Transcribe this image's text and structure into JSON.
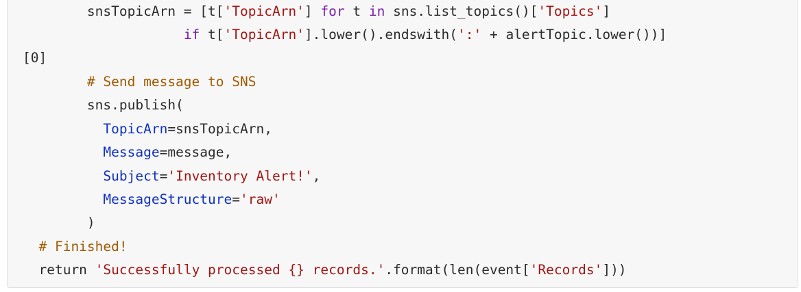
{
  "code": {
    "lines": [
      {
        "indent": "        ",
        "tokens": [
          {
            "t": "snsTopicArn = [t[",
            "c": "plain"
          },
          {
            "t": "'TopicArn'",
            "c": "str"
          },
          {
            "t": "] ",
            "c": "plain"
          },
          {
            "t": "for",
            "c": "kw"
          },
          {
            "t": " t ",
            "c": "plain"
          },
          {
            "t": "in",
            "c": "kw"
          },
          {
            "t": " sns.list_topics()[",
            "c": "plain"
          },
          {
            "t": "'Topics'",
            "c": "str"
          },
          {
            "t": "]",
            "c": "plain"
          }
        ]
      },
      {
        "indent": "                    ",
        "tokens": [
          {
            "t": "if",
            "c": "kw"
          },
          {
            "t": " t[",
            "c": "plain"
          },
          {
            "t": "'TopicArn'",
            "c": "str"
          },
          {
            "t": "].lower().endswith(",
            "c": "plain"
          },
          {
            "t": "':'",
            "c": "str"
          },
          {
            "t": " + alertTopic.lower())]",
            "c": "plain"
          }
        ]
      },
      {
        "indent": "",
        "tokens": [
          {
            "t": "[0]",
            "c": "plain"
          }
        ]
      },
      {
        "indent": "        ",
        "tokens": [
          {
            "t": "# Send message to SNS",
            "c": "cm"
          }
        ]
      },
      {
        "indent": "        ",
        "tokens": [
          {
            "t": "sns.publish(",
            "c": "plain"
          }
        ]
      },
      {
        "indent": "          ",
        "tokens": [
          {
            "t": "TopicArn",
            "c": "arg"
          },
          {
            "t": "=snsTopicArn,",
            "c": "plain"
          }
        ]
      },
      {
        "indent": "          ",
        "tokens": [
          {
            "t": "Message",
            "c": "arg"
          },
          {
            "t": "=message,",
            "c": "plain"
          }
        ]
      },
      {
        "indent": "          ",
        "tokens": [
          {
            "t": "Subject",
            "c": "arg"
          },
          {
            "t": "=",
            "c": "plain"
          },
          {
            "t": "'Inventory Alert!'",
            "c": "str"
          },
          {
            "t": ",",
            "c": "plain"
          }
        ]
      },
      {
        "indent": "          ",
        "tokens": [
          {
            "t": "MessageStructure",
            "c": "arg"
          },
          {
            "t": "=",
            "c": "plain"
          },
          {
            "t": "'raw'",
            "c": "str"
          }
        ]
      },
      {
        "indent": "        ",
        "tokens": [
          {
            "t": ")",
            "c": "plain"
          }
        ]
      },
      {
        "indent": "  ",
        "tokens": [
          {
            "t": "# Finished!",
            "c": "cm"
          }
        ]
      },
      {
        "indent": "  ",
        "tokens": [
          {
            "t": "return",
            "c": "plain"
          },
          {
            "t": " ",
            "c": "plain"
          },
          {
            "t": "'Successfully processed {} records.'",
            "c": "str"
          },
          {
            "t": ".format(len(event[",
            "c": "plain"
          },
          {
            "t": "'Records'",
            "c": "str"
          },
          {
            "t": "]))",
            "c": "plain"
          }
        ]
      }
    ]
  }
}
